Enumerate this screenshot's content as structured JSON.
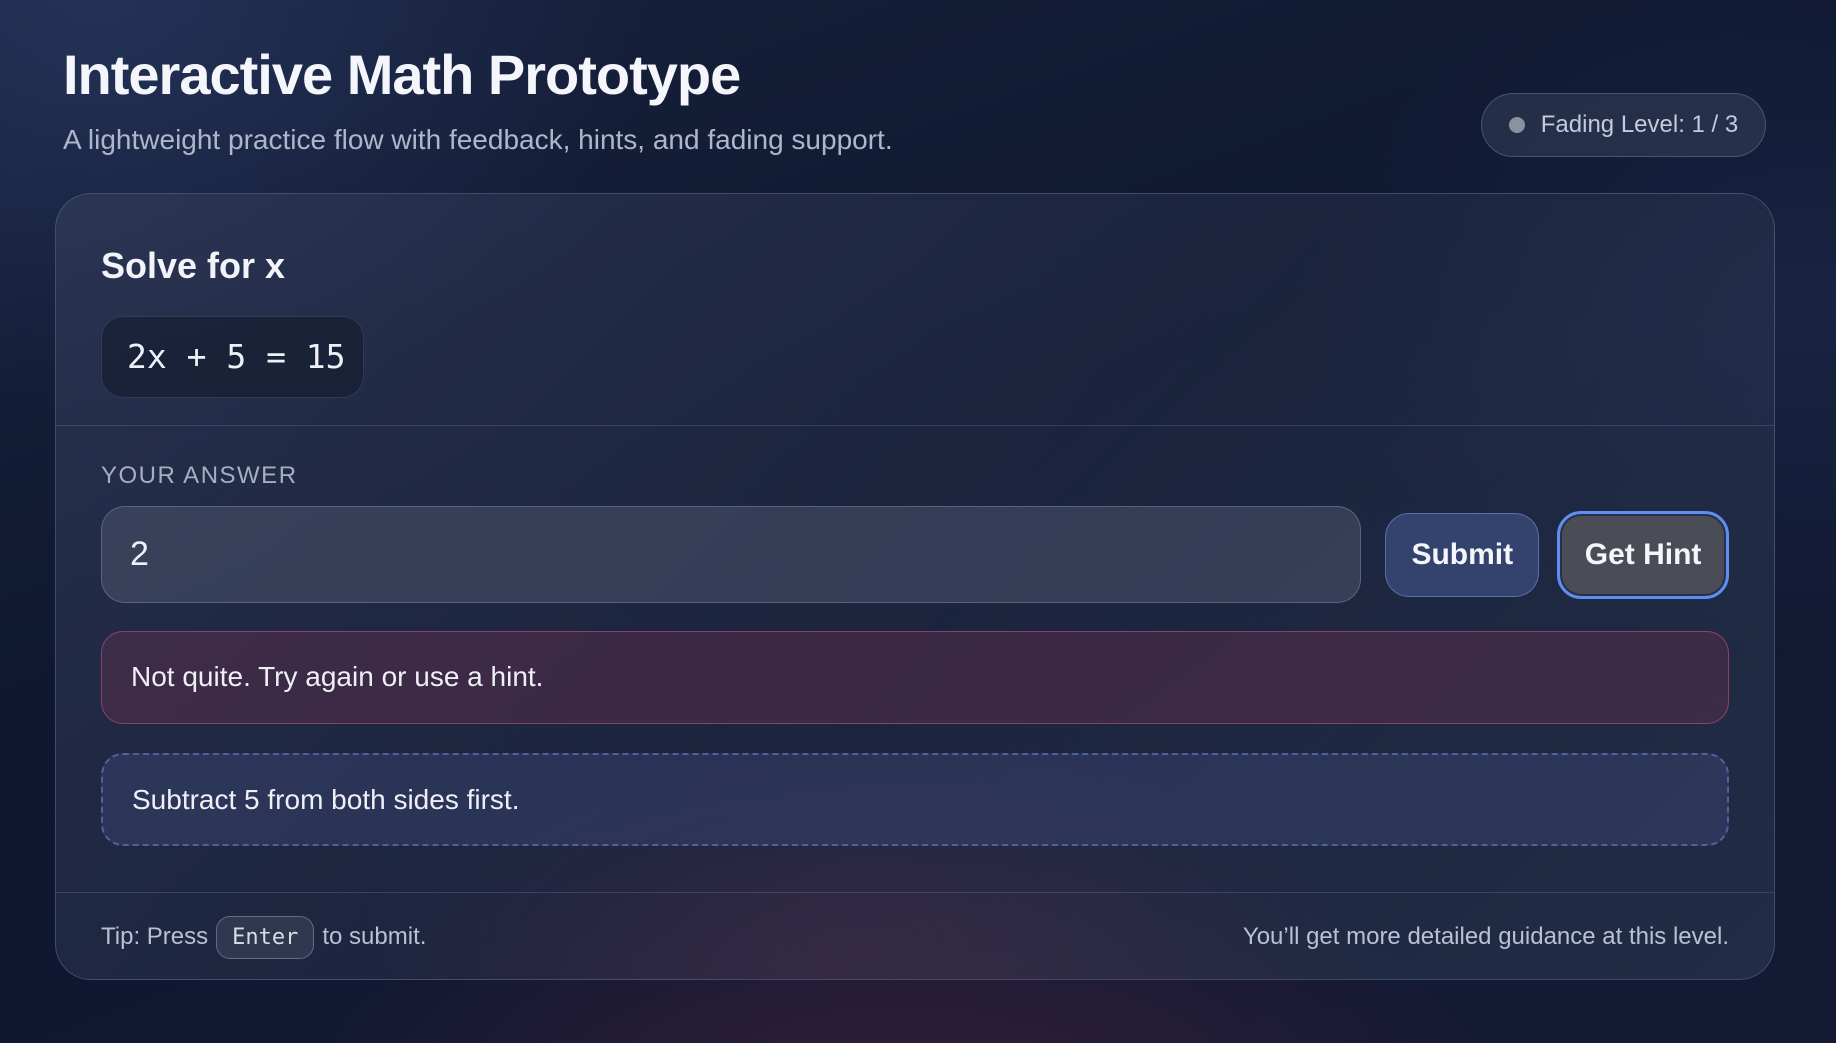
{
  "header": {
    "title": "Interactive Math Prototype",
    "subtitle": "A lightweight practice flow with feedback, hints, and fading support."
  },
  "fading_badge": {
    "label": "Fading Level: 1 / 3"
  },
  "problem": {
    "title": "Solve for x",
    "equation": "2x + 5 = 15"
  },
  "answer": {
    "label": "YOUR ANSWER",
    "value": "2"
  },
  "buttons": {
    "submit": "Submit",
    "hint": "Get Hint"
  },
  "feedback": {
    "message": "Not quite. Try again or use a hint.",
    "status_color": "#c85a78"
  },
  "hint": {
    "text": "Subtract 5 from both sides first."
  },
  "footer": {
    "tip_prefix": "Tip: Press",
    "tip_key": "Enter",
    "tip_suffix": "to submit.",
    "guidance": "You’ll get more detailed guidance at this level."
  }
}
